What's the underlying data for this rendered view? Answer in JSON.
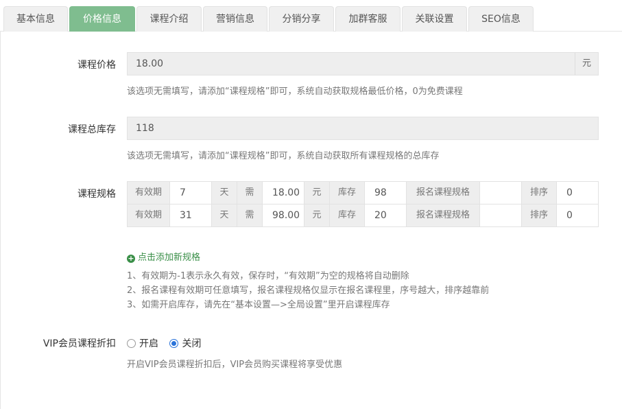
{
  "tabs": [
    {
      "label": "基本信息",
      "active": false
    },
    {
      "label": "价格信息",
      "active": true
    },
    {
      "label": "课程介绍",
      "active": false
    },
    {
      "label": "营销信息",
      "active": false
    },
    {
      "label": "分销分享",
      "active": false
    },
    {
      "label": "加群客服",
      "active": false
    },
    {
      "label": "关联设置",
      "active": false
    },
    {
      "label": "SEO信息",
      "active": false
    }
  ],
  "price": {
    "label": "课程价格",
    "value": "18.00",
    "unit": "元",
    "help": "该选项无需填写，请添加“课程规格”即可，系统自动获取规格最低价格，0为免费课程"
  },
  "stock": {
    "label": "课程总库存",
    "value": "118",
    "help": "该选项无需填写，请添加“课程规格”即可，系统自动获取所有课程规格的总库存"
  },
  "spec": {
    "label": "课程规格",
    "headers": {
      "validity": "有效期",
      "day": "天",
      "need": "需",
      "yuan": "元",
      "stock": "库存",
      "enroll_spec": "报名课程规格",
      "sort": "排序"
    },
    "rows": [
      {
        "validity": "7",
        "price": "18.00",
        "stock": "98",
        "enroll_spec": "",
        "sort": "0"
      },
      {
        "validity": "31",
        "price": "98.00",
        "stock": "20",
        "enroll_spec": "",
        "sort": "0"
      }
    ],
    "add_link": "点击添加新规格",
    "notes": [
      "1、有效期为-1表示永久有效，保存时，“有效期”为空的规格将自动删除",
      "2、报名课程有效期可任意填写，报名课程规格仅显示在报名课程里，序号越大，排序越靠前",
      "3、如需开启库存，请先在“基本设置—>全局设置”里开启课程库存"
    ]
  },
  "vip": {
    "label": "VIP会员课程折扣",
    "options": [
      {
        "label": "开启",
        "checked": false
      },
      {
        "label": "关闭",
        "checked": true
      }
    ],
    "help": "开启VIP会员课程折扣后，VIP会员购买课程将享受优惠"
  }
}
